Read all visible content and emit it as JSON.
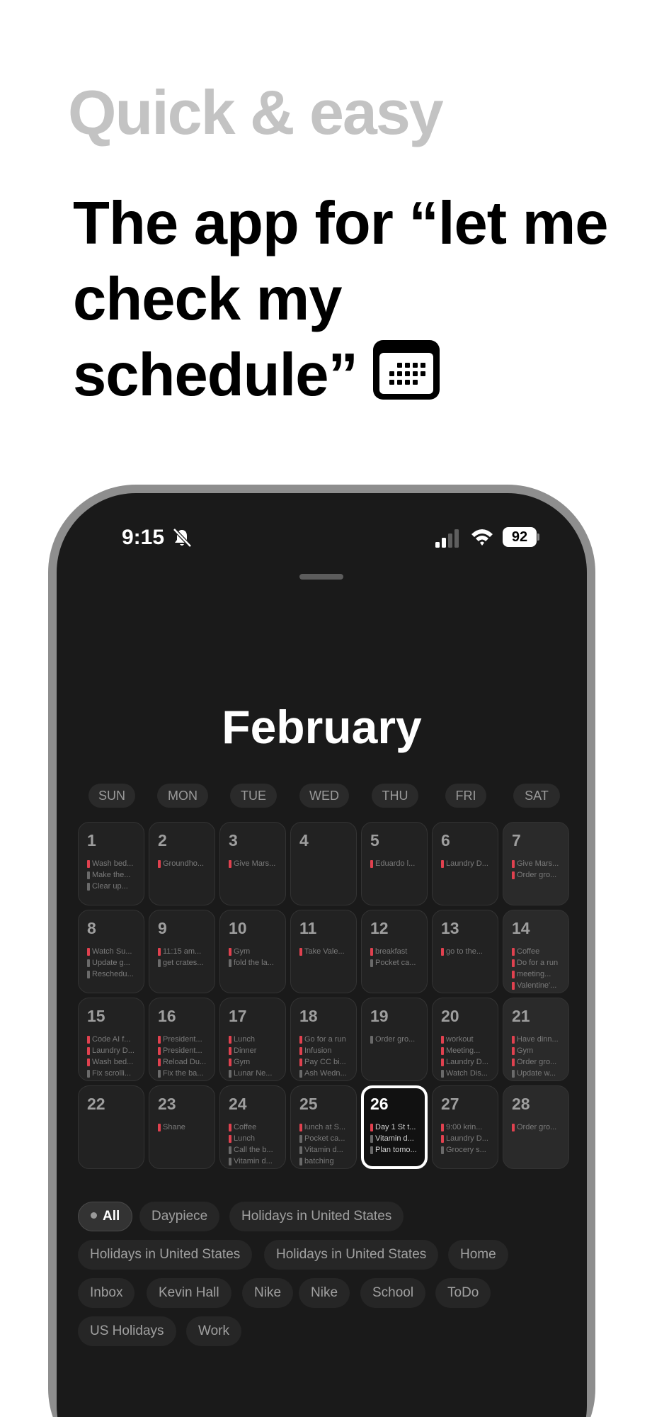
{
  "tagline": "Quick & easy",
  "headline": "The app for “let me check my schedule”",
  "status_bar": {
    "time": "9:15",
    "battery": "92"
  },
  "calendar": {
    "month": "February",
    "weekdays": [
      "SUN",
      "MON",
      "TUE",
      "WED",
      "THU",
      "FRI",
      "SAT"
    ],
    "today": "26",
    "days": [
      {
        "num": "1",
        "events": [
          {
            "t": "Wash bed...",
            "c": "red"
          },
          {
            "t": "Make the...",
            "c": "gray"
          },
          {
            "t": "Clear up...",
            "c": "gray"
          }
        ]
      },
      {
        "num": "2",
        "events": [
          {
            "t": "Groundho...",
            "c": "red"
          }
        ]
      },
      {
        "num": "3",
        "events": [
          {
            "t": "Give Mars...",
            "c": "red"
          }
        ]
      },
      {
        "num": "4",
        "events": []
      },
      {
        "num": "5",
        "events": [
          {
            "t": "Eduardo l...",
            "c": "red"
          }
        ]
      },
      {
        "num": "6",
        "events": [
          {
            "t": "Laundry D...",
            "c": "red"
          }
        ]
      },
      {
        "num": "7",
        "events": [
          {
            "t": "Give Mars...",
            "c": "red"
          },
          {
            "t": "Order gro...",
            "c": "red"
          }
        ]
      },
      {
        "num": "8",
        "events": [
          {
            "t": "Watch Su...",
            "c": "red"
          },
          {
            "t": "Update g...",
            "c": "gray"
          },
          {
            "t": "Reschedu...",
            "c": "gray"
          }
        ]
      },
      {
        "num": "9",
        "events": [
          {
            "t": "11:15 am...",
            "c": "red"
          },
          {
            "t": "get crates...",
            "c": "gray"
          }
        ]
      },
      {
        "num": "10",
        "events": [
          {
            "t": "Gym",
            "c": "red"
          },
          {
            "t": "fold the la...",
            "c": "gray"
          }
        ]
      },
      {
        "num": "11",
        "events": [
          {
            "t": "Take Vale...",
            "c": "red"
          }
        ]
      },
      {
        "num": "12",
        "events": [
          {
            "t": "breakfast",
            "c": "red"
          },
          {
            "t": "Pocket ca...",
            "c": "gray"
          }
        ]
      },
      {
        "num": "13",
        "events": [
          {
            "t": "go to the...",
            "c": "red"
          }
        ]
      },
      {
        "num": "14",
        "events": [
          {
            "t": "Coffee",
            "c": "red"
          },
          {
            "t": "Do for a run",
            "c": "red"
          },
          {
            "t": "meeting...",
            "c": "red"
          },
          {
            "t": "Valentine'...",
            "c": "red"
          }
        ]
      },
      {
        "num": "15",
        "events": [
          {
            "t": "Code AI f...",
            "c": "red"
          },
          {
            "t": "Laundry D...",
            "c": "red"
          },
          {
            "t": "Wash bed...",
            "c": "red"
          },
          {
            "t": "Fix scrolli...",
            "c": "gray"
          }
        ]
      },
      {
        "num": "16",
        "events": [
          {
            "t": "President...",
            "c": "red"
          },
          {
            "t": "President...",
            "c": "red"
          },
          {
            "t": "Reload Du...",
            "c": "red"
          },
          {
            "t": "Fix the ba...",
            "c": "gray"
          }
        ]
      },
      {
        "num": "17",
        "events": [
          {
            "t": "Lunch",
            "c": "red"
          },
          {
            "t": "Dinner",
            "c": "red"
          },
          {
            "t": "Gym",
            "c": "red"
          },
          {
            "t": "Lunar Ne...",
            "c": "gray"
          }
        ]
      },
      {
        "num": "18",
        "events": [
          {
            "t": "Go for a run",
            "c": "red"
          },
          {
            "t": "Infusion",
            "c": "red"
          },
          {
            "t": "Pay CC bi...",
            "c": "red"
          },
          {
            "t": "Ash Wedn...",
            "c": "gray"
          }
        ]
      },
      {
        "num": "19",
        "events": [
          {
            "t": "Order gro...",
            "c": "gray"
          }
        ]
      },
      {
        "num": "20",
        "events": [
          {
            "t": "workout",
            "c": "red"
          },
          {
            "t": "Meeting...",
            "c": "red"
          },
          {
            "t": "Laundry D...",
            "c": "red"
          },
          {
            "t": "Watch Dis...",
            "c": "gray"
          }
        ]
      },
      {
        "num": "21",
        "events": [
          {
            "t": "Have dinn...",
            "c": "red"
          },
          {
            "t": "Gym",
            "c": "red"
          },
          {
            "t": "Order gro...",
            "c": "red"
          },
          {
            "t": "Update w...",
            "c": "gray"
          }
        ]
      },
      {
        "num": "22",
        "events": []
      },
      {
        "num": "23",
        "events": [
          {
            "t": "Shane",
            "c": "red"
          }
        ]
      },
      {
        "num": "24",
        "events": [
          {
            "t": "Coffee",
            "c": "red"
          },
          {
            "t": "Lunch",
            "c": "red"
          },
          {
            "t": "Call the b...",
            "c": "gray"
          },
          {
            "t": "Vitamin d...",
            "c": "gray"
          }
        ]
      },
      {
        "num": "25",
        "events": [
          {
            "t": "lunch at S...",
            "c": "red"
          },
          {
            "t": "Pocket ca...",
            "c": "gray"
          },
          {
            "t": "Vitamin d...",
            "c": "gray"
          },
          {
            "t": "batching",
            "c": "gray"
          }
        ]
      },
      {
        "num": "26",
        "events": [
          {
            "t": "Day 1 St t...",
            "c": "red"
          },
          {
            "t": "Vitamin d...",
            "c": "gray"
          },
          {
            "t": "Plan tomo...",
            "c": "gray"
          }
        ]
      },
      {
        "num": "27",
        "events": [
          {
            "t": "9:00 krin...",
            "c": "red"
          },
          {
            "t": "Laundry D...",
            "c": "red"
          },
          {
            "t": "Grocery s...",
            "c": "gray"
          }
        ]
      },
      {
        "num": "28",
        "events": [
          {
            "t": "Order gro...",
            "c": "red"
          }
        ]
      }
    ]
  },
  "filters": [
    "All",
    "Daypiece",
    "Holidays in United States",
    "Holidays in United States",
    "Holidays in United States",
    "Home",
    "Inbox",
    "Kevin Hall",
    "Nike",
    "Nike",
    "School",
    "ToDo",
    "US Holidays",
    "Work"
  ],
  "colors": {
    "accent_red": "#e0414f",
    "screen_bg": "#1a1a1a",
    "tagline_gray": "#c3c3c3"
  },
  "icons": [
    "calendar-emoji-icon",
    "bell-slash-icon",
    "cellular-signal-icon",
    "wifi-icon",
    "battery-icon"
  ]
}
